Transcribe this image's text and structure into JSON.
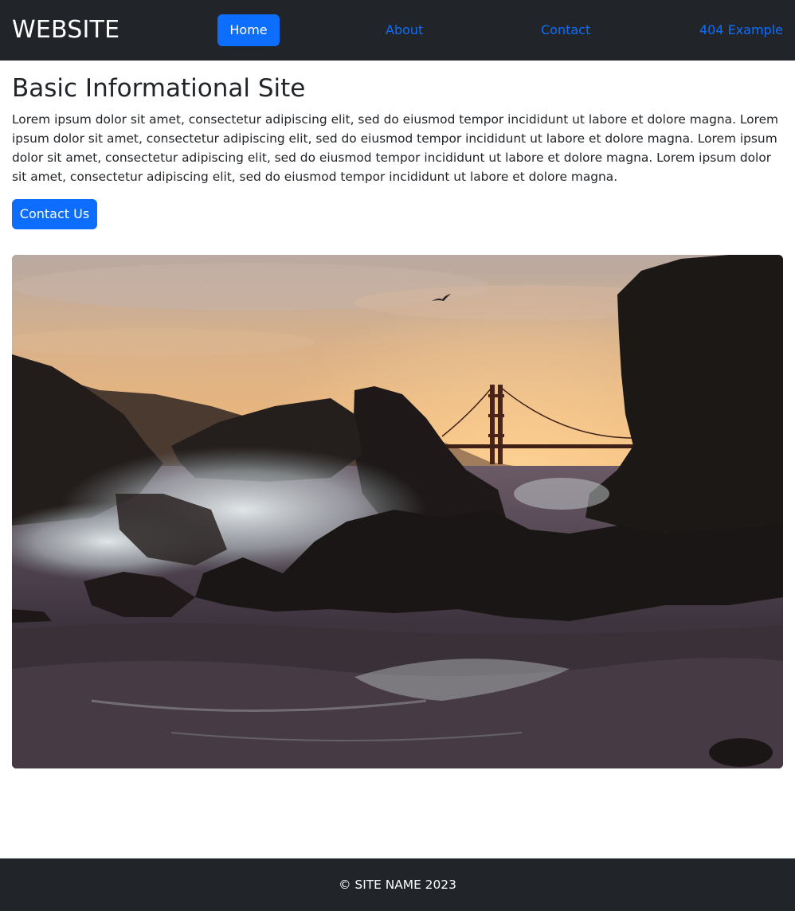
{
  "navbar": {
    "brand": "WEBSITE",
    "links": [
      {
        "label": "Home",
        "active": true
      },
      {
        "label": "About",
        "active": false
      },
      {
        "label": "Contact",
        "active": false
      },
      {
        "label": "404 Example",
        "active": false
      }
    ]
  },
  "main": {
    "title": "Basic Informational Site",
    "paragraph": "Lorem ipsum dolor sit amet, consectetur adipiscing elit, sed do eiusmod tempor incididunt ut labore et dolore magna. Lorem ipsum dolor sit amet, consectetur adipiscing elit, sed do eiusmod tempor incididunt ut labore et dolore magna. Lorem ipsum dolor sit amet, consectetur adipiscing elit, sed do eiusmod tempor incididunt ut labore et dolore magna. Lorem ipsum dolor sit amet, consectetur adipiscing elit, sed do eiusmod tempor incididunt ut labore et dolore magna.",
    "cta_label": "Contact Us",
    "hero_image": "golden-gate-bridge-sunset-rocky-shore-photo"
  },
  "footer": {
    "text": "© SITE NAME 2023"
  },
  "colors": {
    "navbar_bg": "#212529",
    "accent": "#0d6efd",
    "text": "#212529",
    "white": "#ffffff"
  }
}
